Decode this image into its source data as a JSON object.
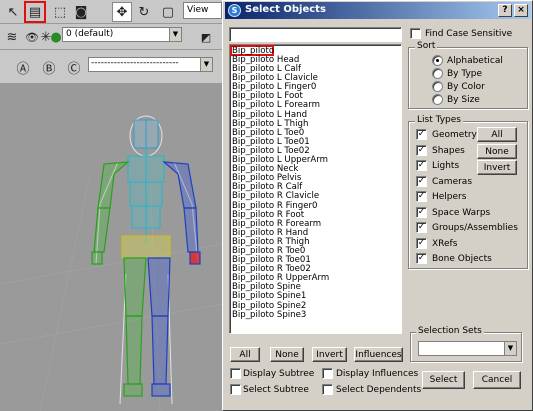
{
  "left": {
    "view_label": "View",
    "layer_value": "0 (default)",
    "selection_set_value": "---------------------------"
  },
  "dialog": {
    "title": "Select Objects",
    "search_value": "",
    "objects": [
      "Bip_piloto",
      "Bip_piloto Head",
      "Bip_piloto L Calf",
      "Bip_piloto L Clavicle",
      "Bip_piloto L Finger0",
      "Bip_piloto L Foot",
      "Bip_piloto L Forearm",
      "Bip_piloto L Hand",
      "Bip_piloto L Thigh",
      "Bip_piloto L Toe0",
      "Bip_piloto L Toe01",
      "Bip_piloto L Toe02",
      "Bip_piloto L UpperArm",
      "Bip_piloto Neck",
      "Bip_piloto Pelvis",
      "Bip_piloto R Calf",
      "Bip_piloto R Clavicle",
      "Bip_piloto R Finger0",
      "Bip_piloto R Foot",
      "Bip_piloto R Forearm",
      "Bip_piloto R Hand",
      "Bip_piloto R Thigh",
      "Bip_piloto R Toe0",
      "Bip_piloto R Toe01",
      "Bip_piloto R Toe02",
      "Bip_piloto R UpperArm",
      "Bip_piloto Spine",
      "Bip_piloto Spine1",
      "Bip_piloto Spine2",
      "Bip_piloto Spine3"
    ],
    "find_case_sensitive": "Find Case Sensitive",
    "sort": {
      "label": "Sort",
      "options": [
        "Alphabetical",
        "By Type",
        "By Color",
        "By Size"
      ],
      "selected": "Alphabetical"
    },
    "list_types": {
      "label": "List Types",
      "items": [
        "Geometry",
        "Shapes",
        "Lights",
        "Cameras",
        "Helpers",
        "Space Warps",
        "Groups/Assemblies",
        "XRefs",
        "Bone Objects"
      ],
      "all_label": "All",
      "none_label": "None",
      "invert_label": "Invert"
    },
    "selection_sets": {
      "label": "Selection Sets",
      "value": ""
    },
    "bottom_buttons": {
      "all": "All",
      "none": "None",
      "invert": "Invert",
      "influences": "Influences"
    },
    "options": {
      "display_subtree": "Display Subtree",
      "display_influences": "Display Influences",
      "select_subtree": "Select Subtree",
      "select_dependents": "Select Dependents"
    },
    "select_label": "Select",
    "cancel_label": "Cancel",
    "help_glyph": "?",
    "close_glyph": "×"
  }
}
